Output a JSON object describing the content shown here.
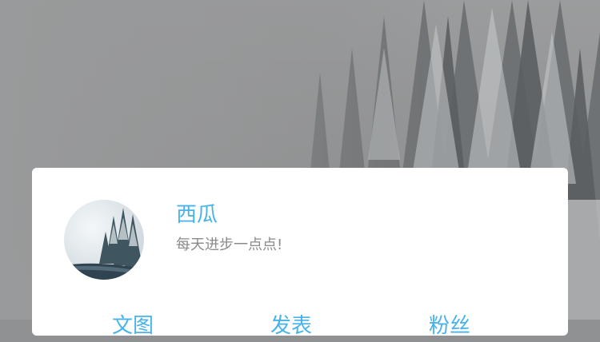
{
  "profile": {
    "name": "西瓜",
    "motto": "每天进步一点点!"
  },
  "stats": [
    {
      "label": "文图"
    },
    {
      "label": "发表"
    },
    {
      "label": "粉丝"
    }
  ],
  "colors": {
    "accent": "#47b3ea",
    "motto": "#8a8a8a",
    "card": "#ffffff"
  }
}
